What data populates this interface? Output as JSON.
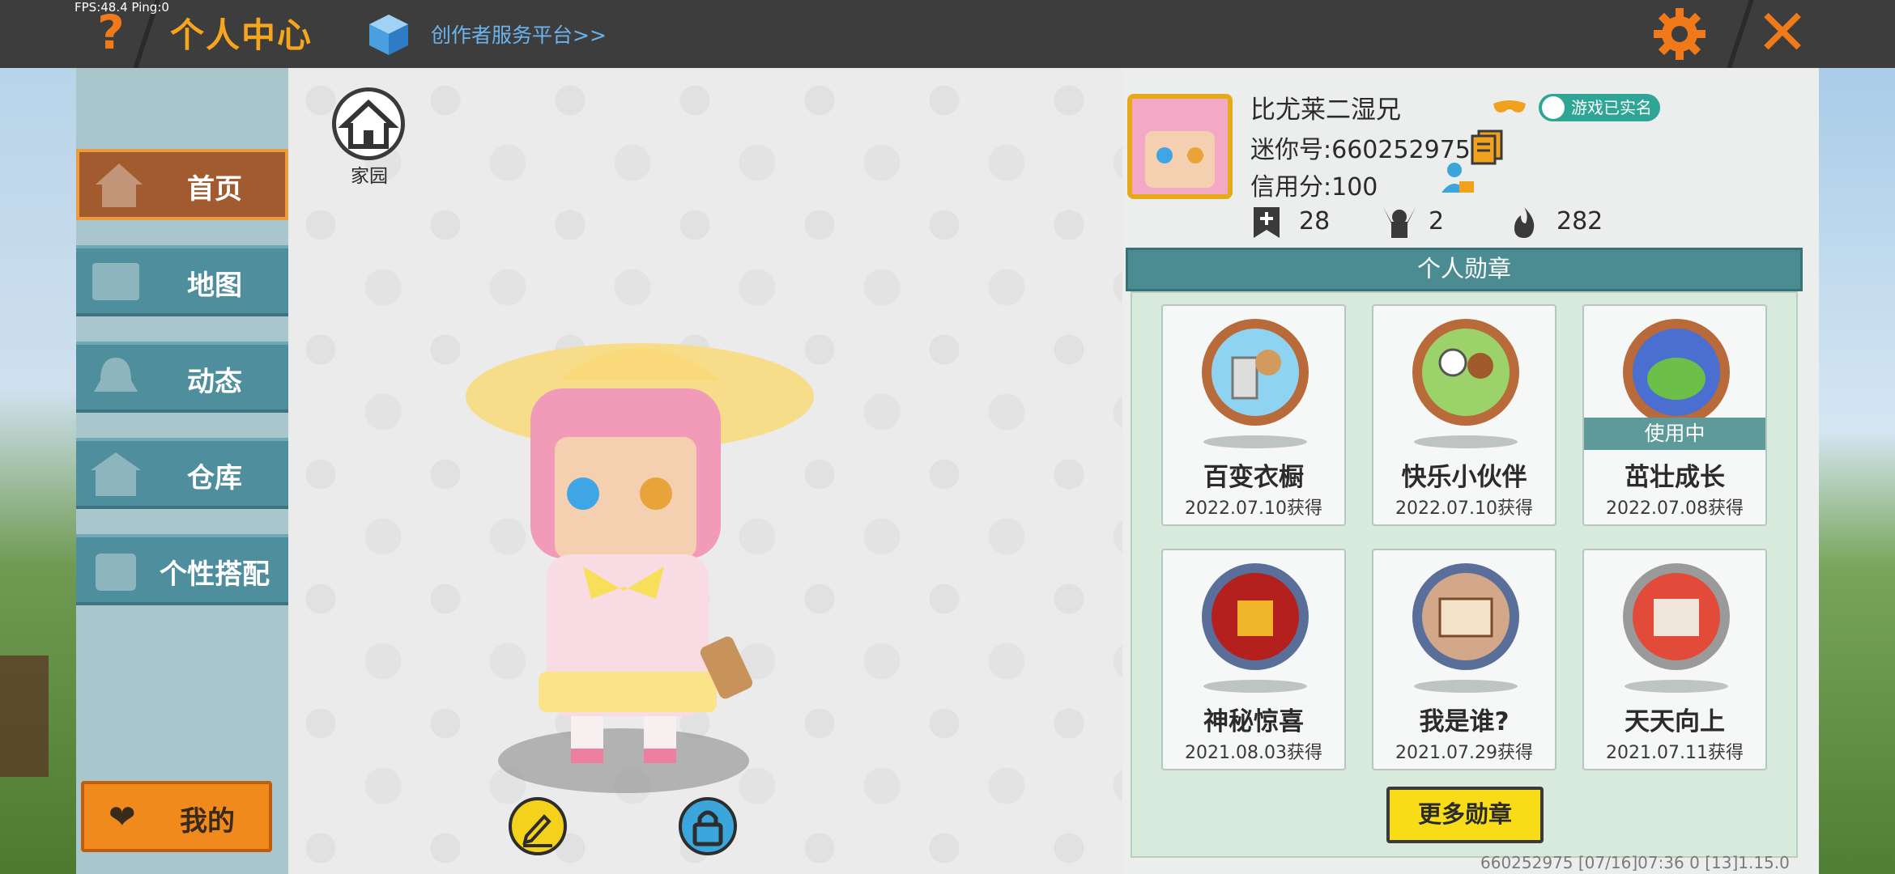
{
  "debug": {
    "fps_text": "FPS:48.4  Ping:0"
  },
  "header": {
    "title": "个人中心",
    "creator_link": "创作者服务平台>>",
    "accent_color": "#f8a51e"
  },
  "sidebar": {
    "tabs": [
      {
        "label": "首页",
        "icon": "home-tab-icon",
        "active": true
      },
      {
        "label": "地图",
        "icon": "map-icon",
        "active": false
      },
      {
        "label": "动态",
        "icon": "bell-icon",
        "active": false
      },
      {
        "label": "仓库",
        "icon": "warehouse-icon",
        "active": false
      },
      {
        "label": "个性搭配",
        "icon": "outfit-icon",
        "active": false
      }
    ],
    "my_button": "我的"
  },
  "home": {
    "label": "家园"
  },
  "profile": {
    "nickname": "比尤莱二湿兄",
    "mini_id": "迷你号:660252975",
    "credit": "信用分:100",
    "verified": "游戏已实名",
    "stats": [
      {
        "icon": "bookmark-plus-icon",
        "value": "28"
      },
      {
        "icon": "fans-icon",
        "value": "2"
      },
      {
        "icon": "flame-icon",
        "value": "282"
      }
    ]
  },
  "medals": {
    "title": "个人勋章",
    "in_use_label": "使用中",
    "items": [
      {
        "name": "百变衣橱",
        "date": "2022.07.10获得",
        "in_use": false,
        "frame": "bronze"
      },
      {
        "name": "快乐小伙伴",
        "date": "2022.07.10获得",
        "in_use": false,
        "frame": "bronze"
      },
      {
        "name": "茁壮成长",
        "date": "2022.07.08获得",
        "in_use": true,
        "frame": "bronze"
      },
      {
        "name": "神秘惊喜",
        "date": "2021.08.03获得",
        "in_use": false,
        "frame": "silver"
      },
      {
        "name": "我是谁?",
        "date": "2021.07.29获得",
        "in_use": false,
        "frame": "silver"
      },
      {
        "name": "天天向上",
        "date": "2021.07.11获得",
        "in_use": false,
        "frame": "silver"
      }
    ],
    "more_button": "更多勋章"
  },
  "footer": {
    "info": "660252975    [07/16]07:36 0   [13]1.15.0"
  }
}
